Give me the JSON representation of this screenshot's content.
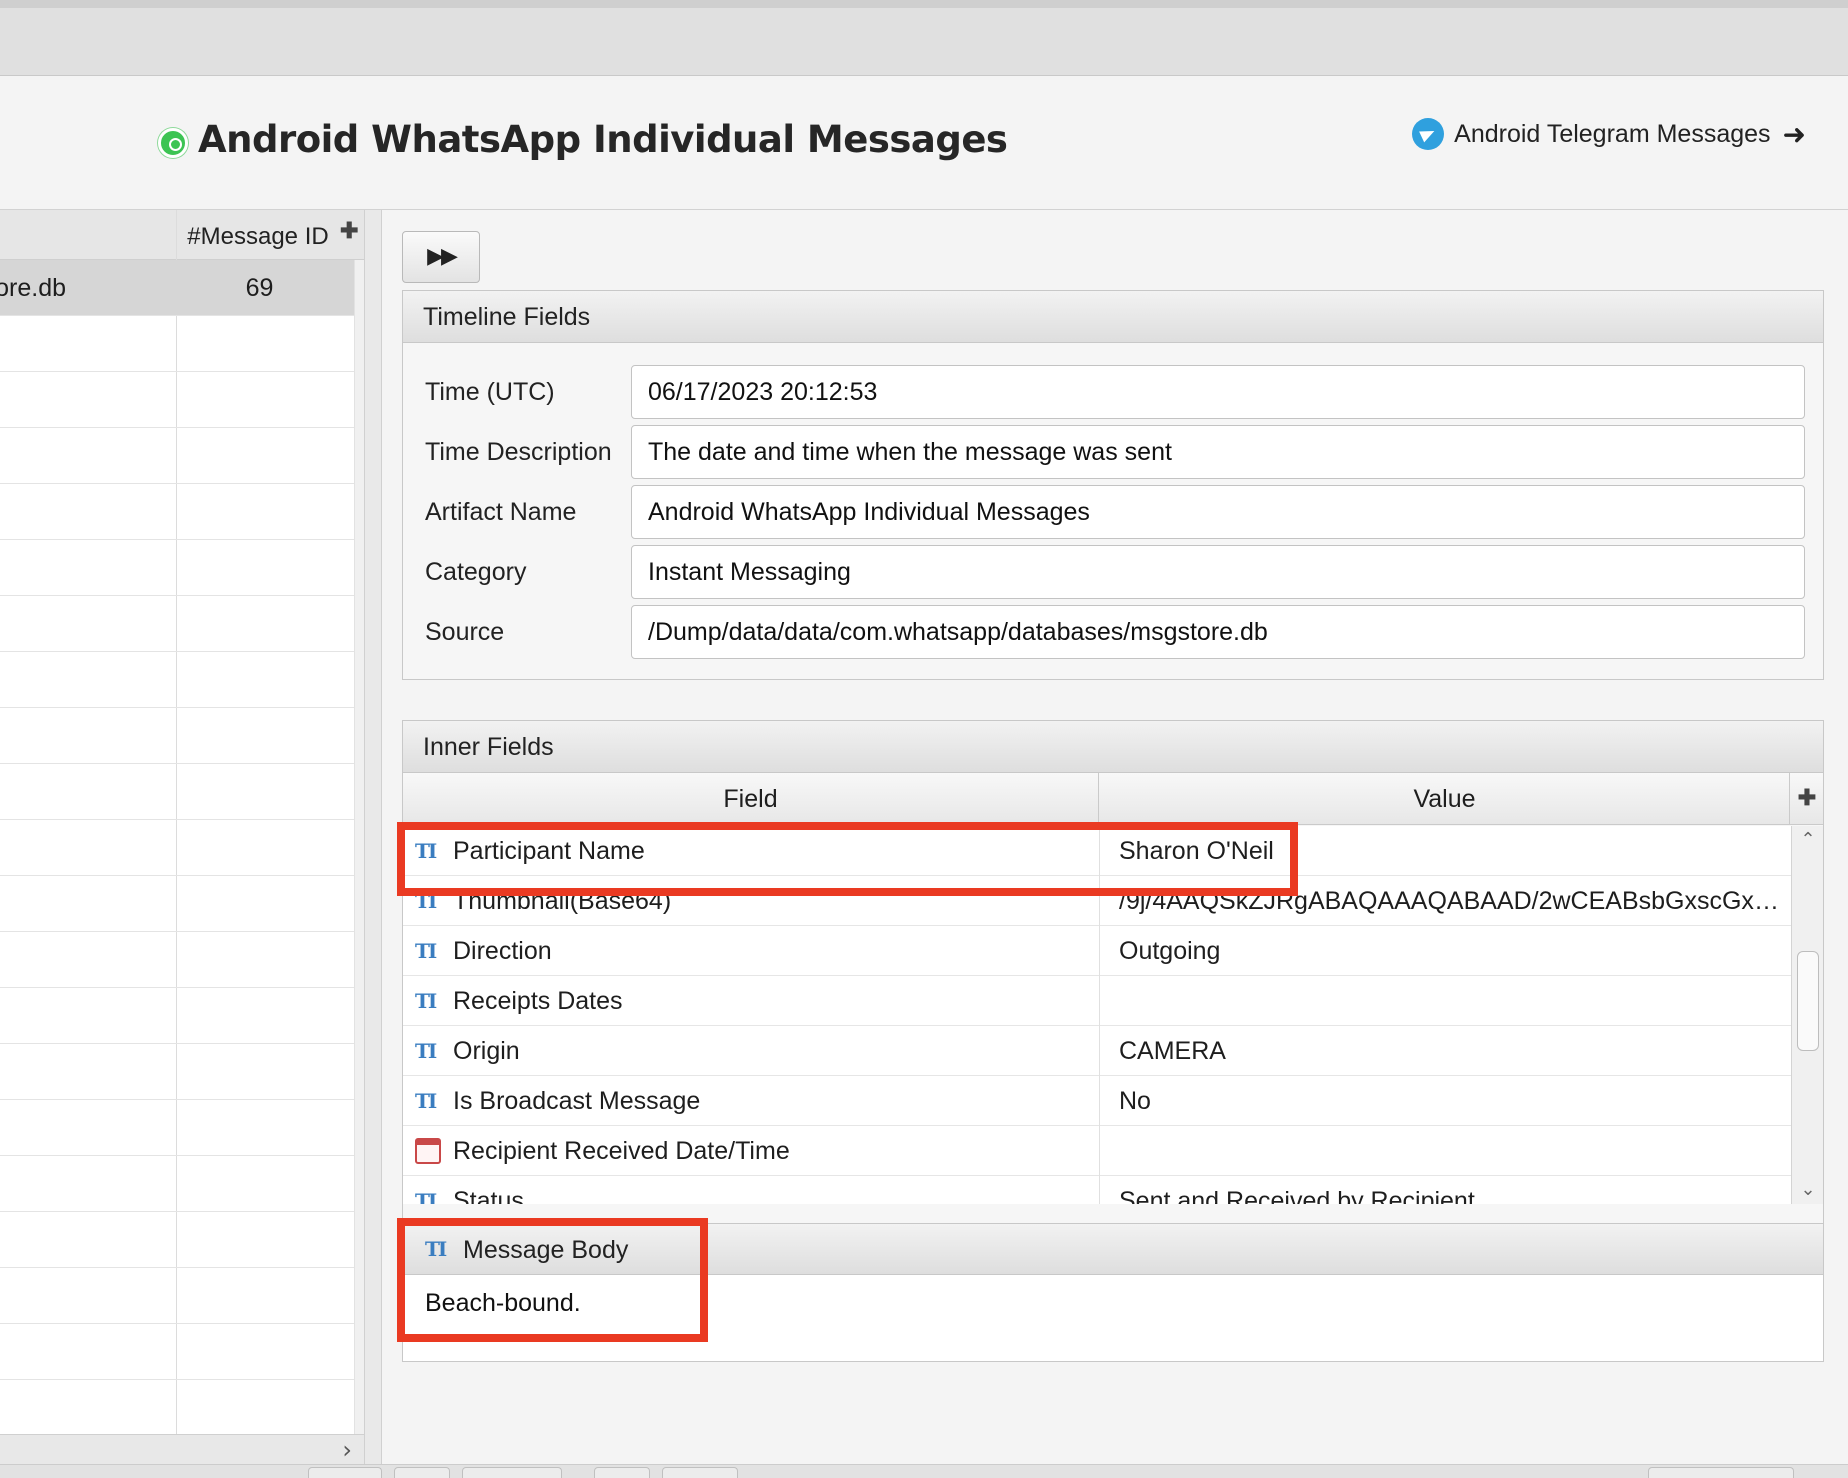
{
  "header": {
    "title": "Android WhatsApp Individual Messages",
    "app_icon": "whatsapp-icon",
    "next_link": {
      "label": "Android Telegram Messages",
      "icon": "telegram-icon",
      "arrow": "➜"
    }
  },
  "left_table": {
    "column_header": "#Message ID",
    "add_column": "✚",
    "rows": [
      {
        "source": "ore.db",
        "message_id": "69",
        "selected": true
      }
    ],
    "scroll_right": "›"
  },
  "toolbar": {
    "forward_label": "▶▶"
  },
  "timeline": {
    "heading": "Timeline Fields",
    "fields": [
      {
        "label": "Time (UTC)",
        "value": "06/17/2023 20:12:53"
      },
      {
        "label": "Time Description",
        "value": "The date and time when the message was sent"
      },
      {
        "label": "Artifact Name",
        "value": "Android WhatsApp Individual Messages"
      },
      {
        "label": "Category",
        "value": "Instant Messaging"
      },
      {
        "label": "Source",
        "value": "/Dump/data/data/com.whatsapp/databases/msgstore.db"
      }
    ]
  },
  "inner": {
    "heading": "Inner Fields",
    "col_field": "Field",
    "col_value": "Value",
    "add_column": "✚",
    "rows": [
      {
        "icon": "text-type-icon",
        "field": "Participant Name",
        "value": "Sharon O'Neil"
      },
      {
        "icon": "text-type-icon",
        "field": "Thumbnail(Base64)",
        "value": "/9j/4AAQSkZJRgABAQAAAQABAAD/2wCEABsbGxscGx4..."
      },
      {
        "icon": "text-type-icon",
        "field": "Direction",
        "value": "Outgoing"
      },
      {
        "icon": "text-type-icon",
        "field": "Receipts Dates",
        "value": ""
      },
      {
        "icon": "text-type-icon",
        "field": "Origin",
        "value": "CAMERA"
      },
      {
        "icon": "text-type-icon",
        "field": "Is Broadcast Message",
        "value": "No"
      },
      {
        "icon": "calendar-icon",
        "field": "Recipient Received Date/Time",
        "value": ""
      },
      {
        "icon": "text-type-icon",
        "field": "Status",
        "value": "Sent and Received by Recipient"
      }
    ],
    "scroll_up": "⌃",
    "scroll_down": "⌄",
    "type_glyph": "TI"
  },
  "message_body": {
    "heading": "Message Body",
    "text": "Beach-bound."
  },
  "colors": {
    "highlight": "#ea3a22",
    "whatsapp_green": "#3cc453",
    "telegram_blue": "#2fa0de",
    "text_icon_blue": "#3a7dc0"
  }
}
